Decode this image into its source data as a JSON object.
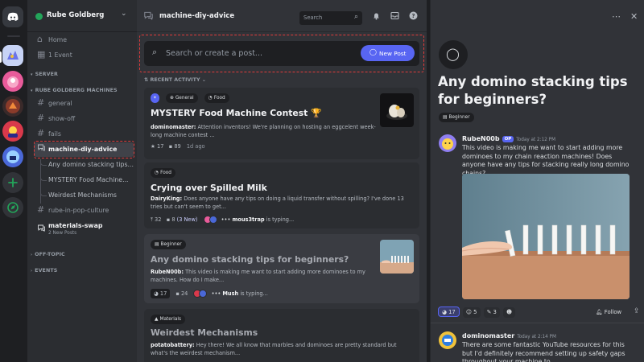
{
  "guild": {
    "name": "Rube Goldberg"
  },
  "sidebar": {
    "home": "Home",
    "event": "1 Event",
    "cat_server": "SERVER",
    "cat_machines": "RUBE GOLDBERG MACHINES",
    "channels": [
      "general",
      "show-off",
      "fails",
      "machine-diy-advice"
    ],
    "threads": [
      "Any domino stacking tips...",
      "MYSTERY Food Machine...",
      "Weirdest Mechanisms"
    ],
    "channel_pop": "rube-in-pop-culture",
    "channel_swap": "materials-swap",
    "swap_sub": "2 New Posts",
    "cat_offtopic": "OFF-TOPIC",
    "cat_events": "EVENTS"
  },
  "forum": {
    "title": "machine-diy-advice",
    "search_placeholder": "Search",
    "post_placeholder": "Search or create a post...",
    "new_post": "New Post",
    "sort_label": "RECENT ACTIVITY",
    "posts": [
      {
        "tags": [
          "General",
          "Food"
        ],
        "title": "MYSTERY Food Machine Contest 🏆",
        "author": "dominomaster:",
        "excerpt": " Attention inventors! We're planning on hosting an eggcelent week-long machine contest ...",
        "reacts": "17",
        "replies": "89",
        "time": "1d ago"
      },
      {
        "tags": [
          "Food"
        ],
        "title": "Crying over Spilled Milk",
        "author": "DairyKing:",
        "excerpt": " Does anyone have any tips on doing a liquid transfer without spilling? I've done 13 tries but can't seem to get...",
        "reacts": "32",
        "replies": "8",
        "replies_new": "(3 New)",
        "typing_name": "mous3trap",
        "typing_suffix": " is typing..."
      },
      {
        "tags": [
          "Beginner"
        ],
        "title": "Any domino stacking tips for beginners?",
        "author": "RubeN00b:",
        "excerpt": " This video is making me want to start adding more dominoes to my machines. How do I make...",
        "reacts": "17",
        "replies": "24",
        "typing_name": "Mush",
        "typing_suffix": " is typing..."
      },
      {
        "tags": [
          "Materials"
        ],
        "title": "Weirdest Mechanisms",
        "author": "potatobattery:",
        "excerpt": " Hey there! We all know that marbles and dominoes are pretty standard but what's the weirdest mechanism..."
      }
    ]
  },
  "thread": {
    "title": "Any domino stacking tips for beginners?",
    "tag": "Beginner",
    "op": {
      "name": "RubeN00b",
      "badge": "OP",
      "time": "Today at 2:12 PM",
      "text": "This video is making me want to start adding more dominoes to my chain reaction machines! Does anyone have any tips for stacking really long domino chains?"
    },
    "reactions": [
      "17",
      "5",
      "3"
    ],
    "follow": "Follow",
    "reply": {
      "name": "dominomaster",
      "time": "Today at 2:14 PM",
      "text": "There are some fantastic YouTube resources for this but I'd definitely recommend setting up safety gaps throughout your machine to..."
    }
  },
  "colors": {
    "accent": "#5865f2",
    "highlight": "#e23b3b",
    "online": "#23a55a"
  },
  "icons": [
    "discord-logo-icon",
    "search-icon",
    "forum-icon",
    "bell-icon",
    "inbox-icon",
    "help-icon",
    "chat-bubble-icon",
    "more-icon",
    "close-icon"
  ]
}
